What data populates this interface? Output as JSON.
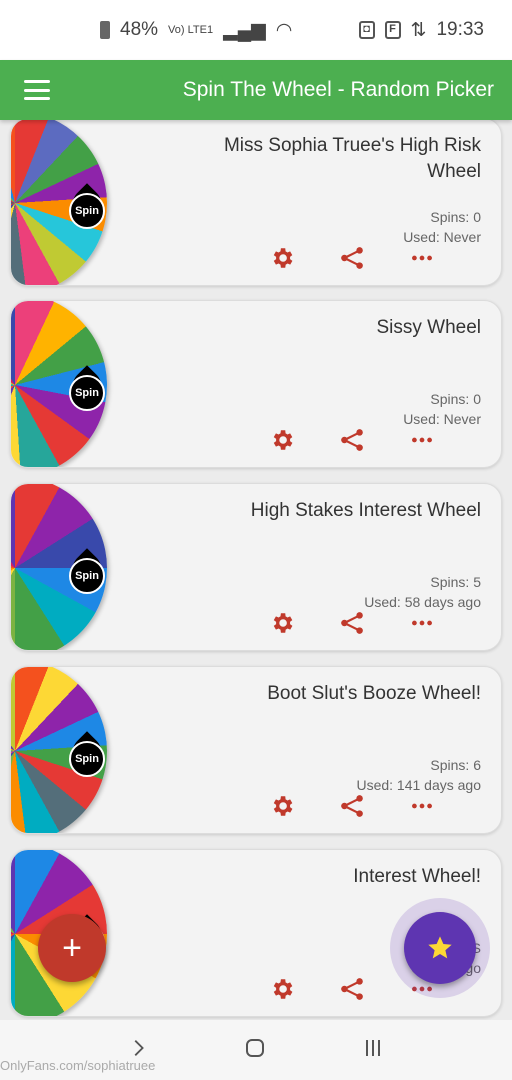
{
  "status_bar": {
    "time": "19:33",
    "battery": "48%",
    "network": "Vo) LTE1"
  },
  "app_bar": {
    "title": "Spin The Wheel - Random Picker"
  },
  "wheels": [
    {
      "title": "Miss Sophia Truee's High Risk Wheel",
      "spins": "Spins: 0",
      "used": "Used: Never"
    },
    {
      "title": "Sissy Wheel",
      "spins": "Spins: 0",
      "used": "Used: Never"
    },
    {
      "title": "High Stakes Interest Wheel",
      "spins": "Spins: 5",
      "used": "Used: 58 days ago"
    },
    {
      "title": "Boot Slut's Booze Wheel!",
      "spins": "Spins: 6",
      "used": "Used: 141 days ago"
    },
    {
      "title": "Interest Wheel!",
      "spins": "S",
      "used": "Us      ays ago"
    }
  ],
  "spin_label": "Spin",
  "fab_add_label": "+",
  "watermark": "OnlyFans.com/sophiatruee",
  "colors": {
    "app_bar": "#4caf50",
    "action_icons": "#c0392b",
    "fab_add": "#c0392b",
    "fab_star": "#5e35b1",
    "star": "#fdd835"
  },
  "icons": [
    "menu-icon",
    "gear-icon",
    "share-icon",
    "more-icon",
    "plus-icon",
    "star-icon",
    "back-icon",
    "home-icon",
    "recents-icon"
  ]
}
